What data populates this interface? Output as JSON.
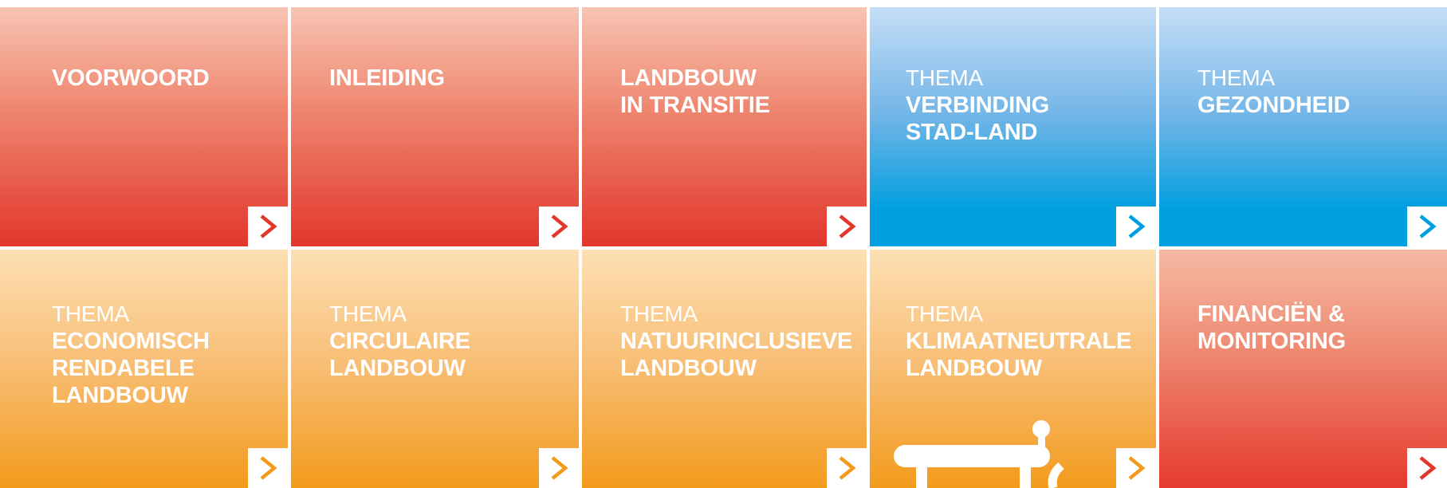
{
  "tiles": [
    {
      "id": "voorwoord",
      "prefix": "",
      "title": "VOORWOORD",
      "theme": "red",
      "arrow_color": "#e2362b",
      "arrow_icon": "chevron-right-icon"
    },
    {
      "id": "inleiding",
      "prefix": "",
      "title": "INLEIDING",
      "theme": "red",
      "arrow_color": "#e2362b",
      "arrow_icon": "chevron-right-icon"
    },
    {
      "id": "landbouw-in-transitie",
      "prefix": "",
      "title": "LANDBOUW\nIN TRANSITIE",
      "theme": "red",
      "arrow_color": "#e2362b",
      "arrow_icon": "chevron-right-icon"
    },
    {
      "id": "verbinding-stad-land",
      "prefix": "THEMA",
      "title": "VERBINDING\nSTAD-LAND",
      "theme": "blue",
      "arrow_color": "#009fdf",
      "arrow_icon": "chevron-right-icon"
    },
    {
      "id": "gezondheid",
      "prefix": "THEMA",
      "title": "GEZONDHEID",
      "theme": "blue",
      "arrow_color": "#009fdf",
      "arrow_icon": "chevron-right-icon"
    },
    {
      "id": "economisch-rendabele-landbouw",
      "prefix": "THEMA",
      "title": "ECONOMISCH\nRENDABELE\nLANDBOUW",
      "theme": "orange",
      "arrow_color": "#f39a1c",
      "arrow_icon": "chevron-right-icon"
    },
    {
      "id": "circulaire-landbouw",
      "prefix": "THEMA",
      "title": "CIRCULAIRE\nLANDBOUW",
      "theme": "orange",
      "arrow_color": "#f39a1c",
      "arrow_icon": "chevron-right-icon"
    },
    {
      "id": "natuurinclusieve-landbouw",
      "prefix": "THEMA",
      "title": "NATUURINCLUSIEVE\nLANDBOUW",
      "theme": "orange",
      "arrow_color": "#f39a1c",
      "arrow_icon": "chevron-right-icon"
    },
    {
      "id": "klimaatneutrale-landbouw",
      "prefix": "THEMA",
      "title": "KLIMAATNEUTRALE\nLANDBOUW",
      "theme": "orange",
      "arrow_color": "#f39a1c",
      "arrow_icon": "chevron-right-icon",
      "illustration": "bench-icon"
    },
    {
      "id": "financien-monitoring",
      "prefix": "",
      "title": "FINANCIËN &\nMONITORING",
      "theme": "red2",
      "arrow_color": "#e2362b",
      "arrow_icon": "chevron-right-icon"
    }
  ],
  "colors": {
    "red": "#e2362b",
    "blue": "#009fdf",
    "orange": "#f39a1c",
    "text": "#ffffff"
  }
}
